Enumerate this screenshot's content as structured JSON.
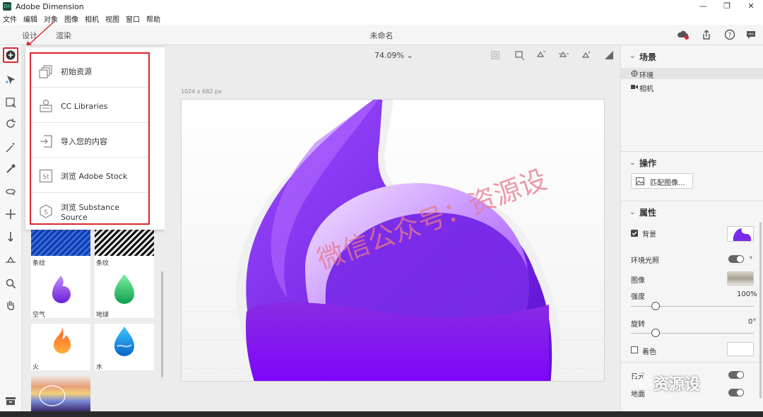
{
  "app": {
    "icon_text": "Dn",
    "title": "Adobe Dimension"
  },
  "window_controls": {
    "minimize": "—",
    "maximize": "❐",
    "close": "✕"
  },
  "menu": [
    "文件",
    "编辑",
    "对象",
    "图像",
    "相机",
    "视图",
    "窗口",
    "帮助"
  ],
  "toolbar": {
    "tabs": [
      "设计",
      "渲染"
    ],
    "doc_title": "未命名",
    "zoom": "74.09%"
  },
  "flyout": {
    "items": [
      {
        "label": "初始资源",
        "icon": "starter-assets-icon"
      },
      {
        "label": "CC Libraries",
        "icon": "cc-libraries-icon"
      },
      {
        "label": "导入您的内容",
        "icon": "import-icon"
      },
      {
        "label": "浏览 Adobe Stock",
        "icon": "adobe-stock-icon"
      },
      {
        "label": "浏览 Substance Source",
        "icon": "substance-icon"
      }
    ]
  },
  "assets": {
    "swatches": [
      {
        "label": "条纹"
      },
      {
        "label": "条纹"
      },
      {
        "label": "空气"
      },
      {
        "label": "地球"
      },
      {
        "label": "火"
      },
      {
        "label": "水"
      }
    ]
  },
  "canvas": {
    "size_label": "1024 x 682 px"
  },
  "right_panel": {
    "scene_heading": "场景",
    "scene_items": [
      "环境",
      "相机"
    ],
    "actions_heading": "操作",
    "match_image_button": "匹配图像...",
    "properties_heading": "属性",
    "background_label": "背景",
    "env_light_label": "环境光照",
    "image_label": "图像",
    "intensity_label": "强度",
    "intensity_value": "100%",
    "intensity_level": 0.2,
    "rotation_label": "旋转",
    "rotation_value": "0°",
    "rotation_level": 0.2,
    "tint_label": "着色",
    "sunlight_label": "日光",
    "ground_label": "地面"
  },
  "watermark": {
    "center": "微信公众号：资源设",
    "corner": "资源设"
  },
  "colors": {
    "accent_red": "#d9272e",
    "purple": "#8a2be2"
  }
}
